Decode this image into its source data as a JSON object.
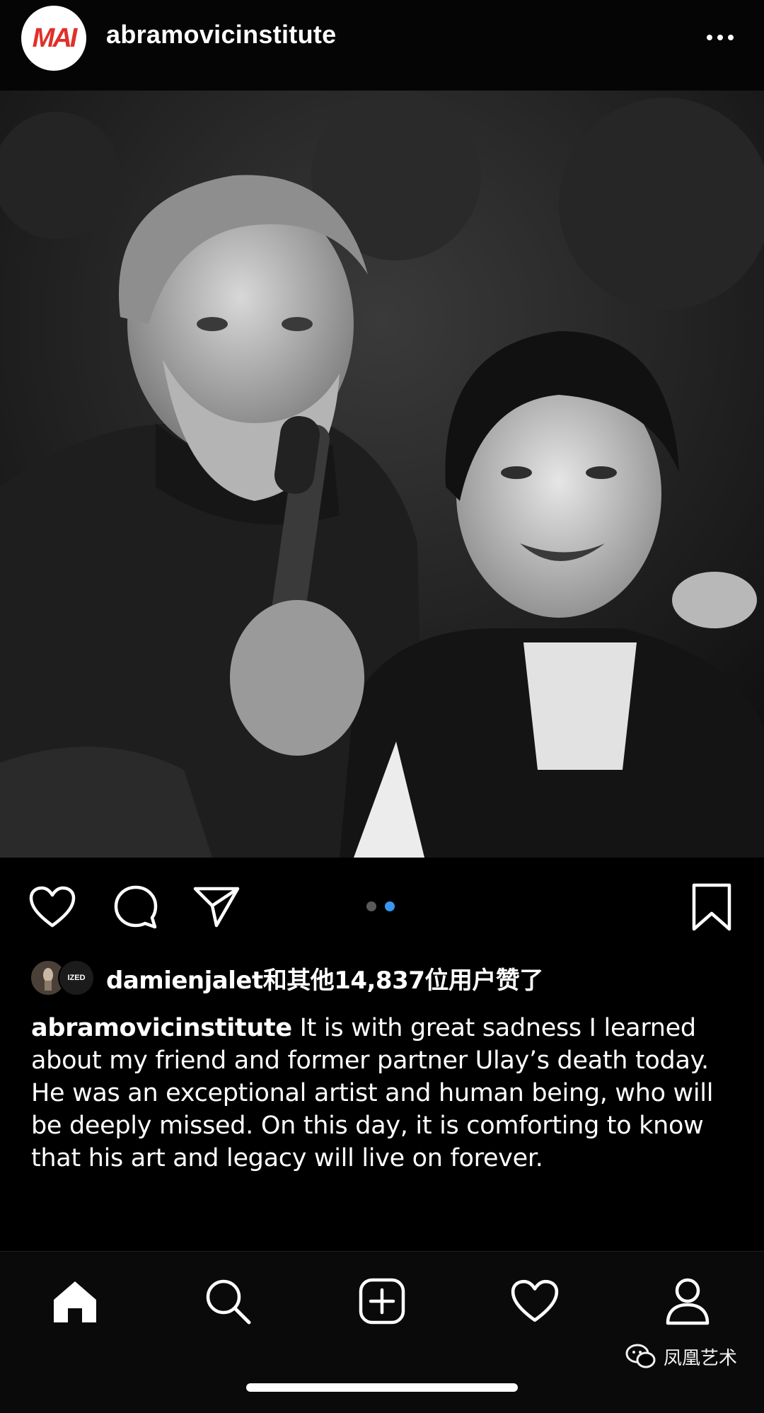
{
  "header": {
    "avatar_text": "MAI",
    "username": "abramovicinstitute",
    "more_icon": "more-horizontal-icon"
  },
  "post": {
    "image_description": "",
    "carousel": {
      "count": 2,
      "active_index": 1,
      "active_color": "#3897f0",
      "inactive_color": "#5a5a5a"
    }
  },
  "actions": {
    "like_icon": "heart-outline-icon",
    "comment_icon": "comment-bubble-icon",
    "share_icon": "paper-plane-icon",
    "save_icon": "bookmark-outline-icon"
  },
  "likes": {
    "liker_badge": "IZED",
    "text": "damienjalet和其他14,837位用户赞了"
  },
  "caption": {
    "username": "abramovicinstitute",
    "text": "It is with great sadness I learned about my friend and former partner Ulay’s death today. He was an exceptional artist and human being, who will be deeply missed. On this day, it is comforting to know that his art and legacy will live on forever."
  },
  "bottom_nav": {
    "items": [
      {
        "name": "home",
        "icon": "home-icon",
        "active": true
      },
      {
        "name": "search",
        "icon": "search-icon",
        "active": false
      },
      {
        "name": "create",
        "icon": "plus-square-icon",
        "active": false
      },
      {
        "name": "activity",
        "icon": "heart-outline-icon",
        "active": false
      },
      {
        "name": "profile",
        "icon": "person-icon",
        "active": false
      }
    ]
  },
  "watermark": {
    "text": "凤凰艺术",
    "icon": "wechat-icon"
  },
  "colors": {
    "background": "#000000",
    "logo_red": "#e0302a",
    "carousel_active": "#3897f0"
  }
}
